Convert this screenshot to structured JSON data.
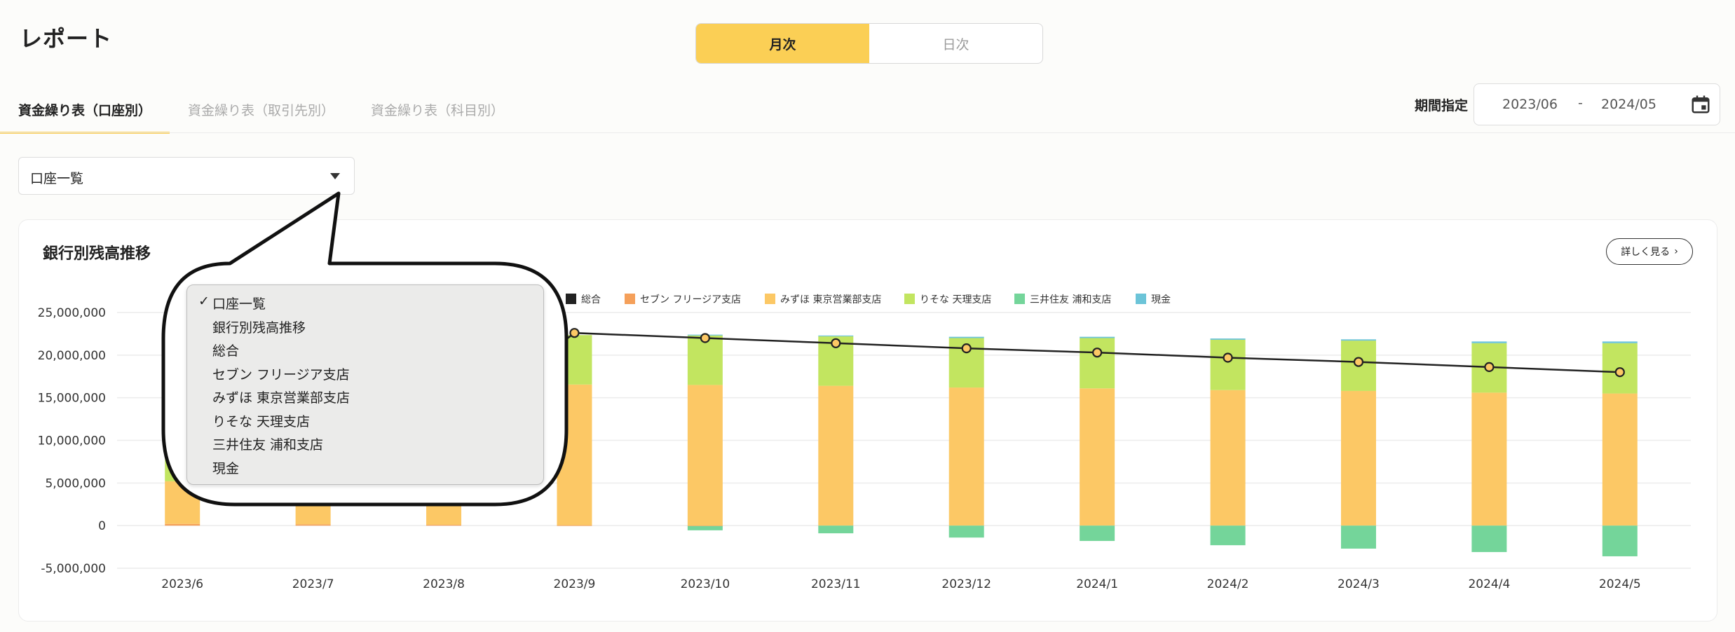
{
  "page": {
    "title": "レポート"
  },
  "period_toggle": {
    "monthly": "月次",
    "daily": "日次",
    "selected": "monthly"
  },
  "tabs": [
    {
      "label": "資金繰り表（口座別）",
      "active": true
    },
    {
      "label": "資金繰り表（取引先別）",
      "active": false
    },
    {
      "label": "資金繰り表（科目別）",
      "active": false
    }
  ],
  "date_range": {
    "label": "期間指定",
    "start": "2023/06",
    "separator": "-",
    "end": "2024/05"
  },
  "account_select": {
    "value": "口座一覧"
  },
  "chart_card": {
    "title": "銀行別残高推移",
    "details_button": "詳しく見る"
  },
  "dropdown": {
    "check_mark": "✓",
    "items": [
      "口座一覧",
      "銀行別残高推移",
      "総合",
      "セブン フリージア支店",
      "みずほ 東京営業部支店",
      "りそな 天理支店",
      "三井住友 浦和支店",
      "現金"
    ],
    "selected_index": 0
  },
  "colors": {
    "accent": "#fbcf55",
    "total": "#222222",
    "seven": "#f5a05a",
    "mizuho": "#fcc865",
    "resona": "#c2e560",
    "smbc": "#74d59a",
    "cash": "#6cc4d8"
  },
  "chart_data": {
    "type": "bar",
    "stacked": true,
    "categories": [
      "2023/6",
      "2023/7",
      "2023/8",
      "2023/9",
      "2023/10",
      "2023/11",
      "2023/12",
      "2024/1",
      "2024/2",
      "2024/3",
      "2024/4",
      "2024/5"
    ],
    "ylim": [
      -5000000,
      25000000
    ],
    "y_ticks": [
      "25,000,000",
      "20,000,000",
      "15,000,000",
      "10,000,000",
      "5,000,000",
      "0",
      "-5,000,000"
    ],
    "y_tick_values": [
      25000000,
      20000000,
      15000000,
      10000000,
      5000000,
      0,
      -5000000
    ],
    "grid": true,
    "legend_position": "top",
    "series": [
      {
        "name": "セブン フリージア支店",
        "color_key": "seven",
        "values": [
          200000,
          150000,
          100000,
          50000,
          -50000,
          0,
          0,
          0,
          0,
          0,
          0,
          0
        ]
      },
      {
        "name": "みずほ 東京営業部支店",
        "color_key": "mizuho",
        "values": [
          5000000,
          5000000,
          5000000,
          16500000,
          16500000,
          16400000,
          16200000,
          16100000,
          15900000,
          15800000,
          15600000,
          15500000
        ]
      },
      {
        "name": "りそな 天理支店",
        "color_key": "resona",
        "values": [
          5800000,
          5700000,
          5700000,
          5800000,
          5800000,
          5800000,
          5800000,
          5900000,
          5900000,
          5900000,
          5800000,
          5900000
        ]
      },
      {
        "name": "三井住友 浦和支店",
        "color_key": "smbc",
        "values": [
          0,
          0,
          0,
          0,
          -500000,
          -900000,
          -1400000,
          -1800000,
          -2300000,
          -2700000,
          -3100000,
          -3600000
        ]
      },
      {
        "name": "現金",
        "color_key": "cash",
        "values": [
          0,
          0,
          0,
          0,
          100000,
          100000,
          150000,
          150000,
          150000,
          150000,
          200000,
          200000
        ]
      }
    ],
    "line": {
      "name": "総合",
      "color_key": "total",
      "values": [
        11000000,
        10900000,
        10800000,
        22600000,
        22000000,
        21400000,
        20800000,
        20300000,
        19700000,
        19200000,
        18600000,
        18000000
      ]
    }
  }
}
